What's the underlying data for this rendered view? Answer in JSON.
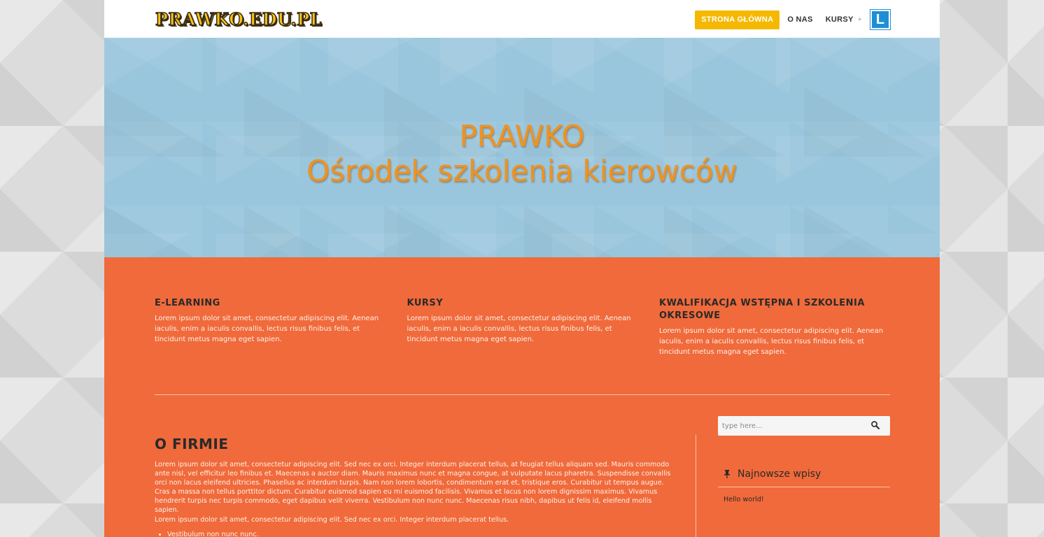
{
  "header": {
    "logo": "PRAWKO.EDU.PL",
    "nav": {
      "home": "STRONA GŁÓWNA",
      "about": "O NAS",
      "courses": "KURSY",
      "courses_plus": "+",
      "badge": "L"
    }
  },
  "hero": {
    "title": "PRAWKO",
    "subtitle": "Ośrodek szkolenia kierowców"
  },
  "features": [
    {
      "title": "E-LEARNING",
      "text": "Lorem ipsum dolor sit amet, consectetur adipiscing elit. Aenean iaculis, enim a iaculis convallis, lectus risus finibus felis, et tincidunt metus magna eget sapien."
    },
    {
      "title": "KURSY",
      "text": "Lorem ipsum dolor sit amet, consectetur adipiscing elit. Aenean iaculis, enim a iaculis convallis, lectus risus finibus felis, et tincidunt metus magna eget sapien."
    },
    {
      "title": "KWALIFIKACJA WSTĘPNA I SZKOLENIA OKRESOWE",
      "text": "Lorem ipsum dolor sit amet, consectetur adipiscing elit. Aenean iaculis, enim a iaculis convallis, lectus risus finibus felis, et tincidunt metus magna eget sapien."
    }
  ],
  "about": {
    "title": "O FIRMIE",
    "paragraph1": "Lorem ipsum dolor sit amet, consectetur adipiscing elit. Sed nec ex orci. Integer interdum placerat tellus, at feugiat tellus aliquam sed. Mauris commodo ante nisl, vel efficitur leo finibus et. Maecenas a auctor diam. Mauris maximus nunc et magna congue, at vulputate lacus pharetra. Suspendisse convallis orci non lacus eleifend ultricies. Phasellus ac interdum turpis. Nam non lorem lobortis, condimentum erat et, tristique eros. Curabitur ut tempus augue. Cras a massa non tellus porttitor dictum. Curabitur euismod sapien eu mi euismod facilisis. Vivamus et lacus non lorem dignissim maximus. Vivamus hendrerit turpis nec turpis commodo, eget dapibus velit viverra. Vestibulum non nunc nunc. Maecenas risus nibh, dapibus ut felis id, eleifend mollis sapien.",
    "paragraph2": "Lorem ipsum dolor sit amet, consectetur adipiscing elit. Sed nec ex orci. Integer interdum placerat tellus.",
    "list": [
      "Vestibulum non nunc nunc."
    ]
  },
  "sidebar": {
    "search_placeholder": "type here...",
    "search_icon": "search-icon",
    "widget_icon": "pin-icon",
    "widget_title": "Najnowsze wpisy",
    "posts": [
      "Hello world!"
    ]
  },
  "colors": {
    "accent": "#f5b800",
    "content_bg": "#f06a3b",
    "hero_bg": "#9ac6dd",
    "hero_text": "#f0921e",
    "badge_blue": "#1e8fd6"
  }
}
